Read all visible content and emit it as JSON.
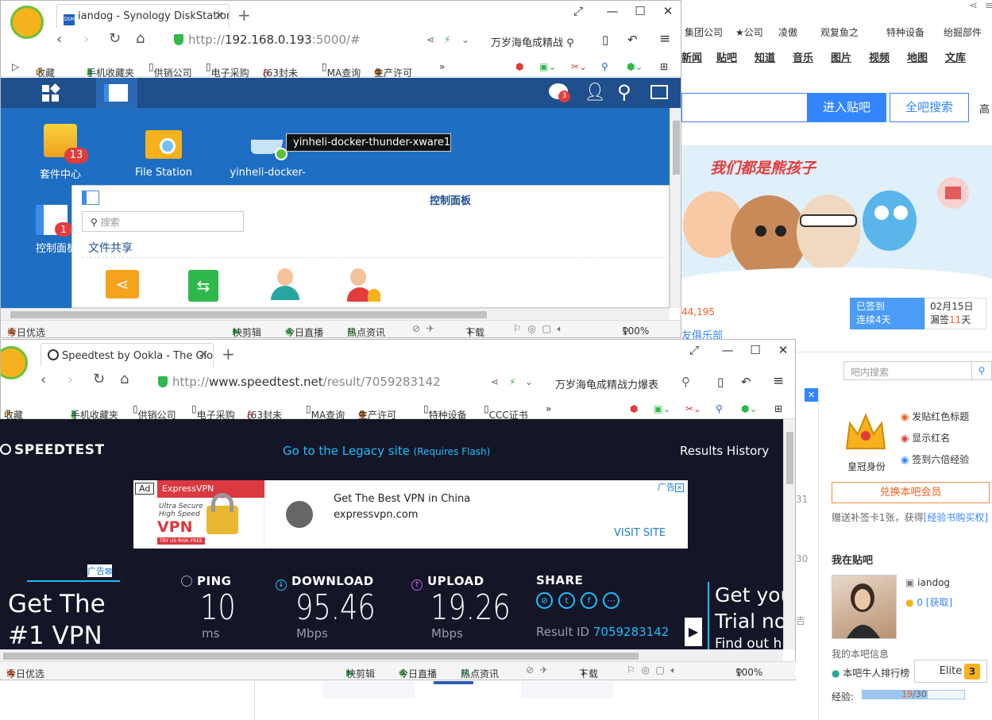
{
  "bg": {
    "bookmarks": [
      "集团公司",
      "★公司",
      "凌傲",
      "观复鱼之",
      "特种设备",
      "绐掘部件"
    ],
    "nav": [
      "新闻",
      "贴吧",
      "知道",
      "音乐",
      "图片",
      "视频",
      "地图",
      "文库"
    ],
    "enter_bar": "进入贴吧",
    "search_all": "全吧搜索",
    "high": "高",
    "banner_text": "我们都是熊孩子",
    "stat": "44,195",
    "club": "友俱乐部",
    "checkin_title": "已签到",
    "checkin_days": "连续4天",
    "date": "02月15日",
    "missed_prefix": "漏签",
    "missed_days": "11",
    "missed_suffix": "天",
    "bar_search_placeholder": "吧内搜索",
    "perks": [
      "发贴红色标题",
      "显示红名",
      "签到六倍经验"
    ],
    "crown_label": "皇冠身份",
    "redeem": "兑换本吧会员",
    "gift_text_prefix": "赠送补签卡1张，获得",
    "gift_link": "[经验书购买权]",
    "my_bar": "我在贴吧",
    "username": "iandog",
    "coins": "0",
    "get_link": "[获取]",
    "bar_info": "我的本吧信息",
    "rank_label": "本吧牛人排行榜",
    "level_name": "Elite",
    "level_num": "3",
    "exp_label": "经验:",
    "exp_value": "19",
    "exp_total": "/30",
    "side_nums": [
      "31",
      "30",
      "吉"
    ]
  },
  "dsm_browser": {
    "tab_title": "iandog - Synology DiskStation",
    "tab_icon_text": "DSM",
    "url_prefix": "http://",
    "url_host": "192.168.0.193",
    "url_rest": ":5000/#",
    "search_text": "万岁海龟成精战",
    "bookmarks": [
      "收藏",
      "手机收藏夹",
      "供销公司",
      "电子采购",
      "(63封未",
      "MA查询",
      "生产许可"
    ],
    "more": "»",
    "apps": [
      {
        "label": "套件中心",
        "badge": "13"
      },
      {
        "label": "File Station"
      },
      {
        "label": "yinheli-docker-"
      },
      {
        "label": "控制面板",
        "badge": "1"
      }
    ],
    "tooltip": "yinheli-docker-thunder-xware1",
    "notif_count": "3",
    "cp_title": "控制面板",
    "cp_search": "搜索",
    "cp_section": "文件共享",
    "status": [
      "今日优选",
      "快剪辑",
      "今日直播",
      "热点资讯",
      "下载",
      "100%"
    ]
  },
  "st_browser": {
    "tab_title": "Speedtest by Ookla - The Glo",
    "url_prefix": "http://",
    "url_host": "www.speedtest.net",
    "url_rest": "/result/7059283142",
    "search_text": "万岁海龟成精战力爆表",
    "bookmarks": [
      "收藏",
      "手机收藏夹",
      "供销公司",
      "电子采购",
      "(63封未",
      "MA查询",
      "生产许可",
      "特种设备",
      "CCC证书"
    ],
    "more": "»",
    "status": [
      "今日优选",
      "快剪辑",
      "今日直播",
      "热点资讯",
      "下载",
      "100%"
    ]
  },
  "speedtest": {
    "logo": "SPEEDTEST",
    "legacy": "Go to the Legacy site",
    "legacy_note": "(Requires Flash)",
    "history": "Results History",
    "ad_tag": "Ad",
    "ad_brand": "ExpressVPN",
    "ad_img_line1": "Ultra Secure",
    "ad_img_line2": "High Speed",
    "ad_img_vpn": "VPN",
    "ad_img_try": "TRY US RISK FREE",
    "ad_headline": "Get The Best VPN in China",
    "ad_domain": "expressvpn.com",
    "ad_cta": "VISIT SITE",
    "ad_label": "广告",
    "side_ad_left": "Get The #1 VPN",
    "side_ad_right_1": "Get you",
    "side_ad_right_2": "Trial no",
    "side_ad_right_3": "Find out h",
    "ping_label": "PING",
    "ping_value": "10",
    "ping_unit": "ms",
    "down_label": "DOWNLOAD",
    "down_value": "95.46",
    "down_unit": "Mbps",
    "up_label": "UPLOAD",
    "up_value": "19.26",
    "up_unit": "Mbps",
    "share_label": "SHARE",
    "result_label": "Result ID",
    "result_id": "7059283142"
  }
}
